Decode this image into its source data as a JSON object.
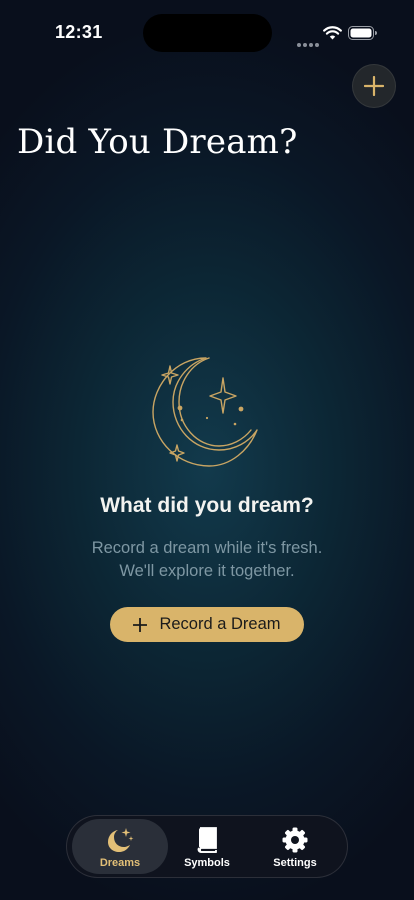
{
  "status_bar": {
    "time": "12:31"
  },
  "header": {
    "title": "Did You Dream?",
    "add_icon": "plus-icon"
  },
  "empty_state": {
    "icon": "crescent-moon-stars-icon",
    "heading": "What did you dream?",
    "body_line1": "Record a dream while it's fresh.",
    "body_line2": "We'll explore it together.",
    "button_label": "Record a Dream",
    "button_icon": "plus-icon"
  },
  "tabs": [
    {
      "label": "Dreams",
      "icon": "moon-stars-icon",
      "active": true
    },
    {
      "label": "Symbols",
      "icon": "book-icon",
      "active": false
    },
    {
      "label": "Settings",
      "icon": "gear-icon",
      "active": false
    }
  ],
  "colors": {
    "accent_gold": "#d9b46a",
    "tab_active_label": "#e2bf77",
    "body_text": "#7e97a3",
    "background_top": "#0a1726",
    "background_glow": "#123a4c"
  }
}
